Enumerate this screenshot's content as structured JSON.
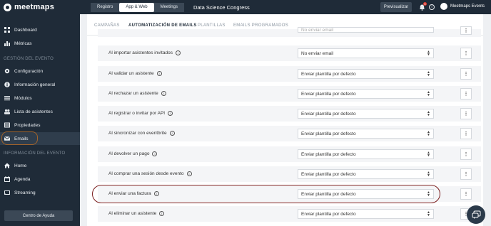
{
  "brand": {
    "name": "meetmaps"
  },
  "sidebar": {
    "items_top": [
      {
        "label": "Dashboard",
        "icon": "dashboard-icon"
      },
      {
        "label": "Métricas",
        "icon": "chart-icon"
      }
    ],
    "section_event": "GESTIÓN DEL EVENTO",
    "items_event": [
      {
        "label": "Configuración",
        "icon": "gear-icon"
      },
      {
        "label": "Información general",
        "icon": "info-icon"
      },
      {
        "label": "Módulos",
        "icon": "list-icon"
      },
      {
        "label": "Lista de asistentes",
        "icon": "users-icon"
      },
      {
        "label": "Propiedades",
        "icon": "properties-icon"
      },
      {
        "label": "Emails",
        "icon": "mail-icon"
      }
    ],
    "section_info": "INFORMACIÓN DEL EVENTO",
    "items_info": [
      {
        "label": "Home",
        "icon": "home-icon"
      },
      {
        "label": "Agenda",
        "icon": "calendar-icon"
      },
      {
        "label": "Streaming",
        "icon": "streaming-icon"
      }
    ],
    "help_label": "Centro de Ayuda"
  },
  "topbar": {
    "tabs": [
      "Registro",
      "App & Web",
      "Meetings"
    ],
    "active_tab": "App & Web",
    "event_name": "Data Science Congress",
    "preview_label": "Previsualizar",
    "notification_count": "5",
    "account_name": "Meetmaps Events"
  },
  "subtabs": {
    "items": [
      "CAMPAÑAS",
      "AUTOMATIZACIÓN DE EMAILS",
      "PLANTILLAS",
      "EMAILS PROGRAMADOS"
    ],
    "active": "AUTOMATIZACIÓN DE EMAILS"
  },
  "rules": [
    {
      "label": "Al importar asistentes invitados",
      "value": "No enviar email"
    },
    {
      "label": "Al validar un asistente",
      "value": "Enviar plantilla por defecto"
    },
    {
      "label": "Al rechazar un asistente",
      "value": "Enviar plantilla por defecto"
    },
    {
      "label": "Al registrar o invitar por API",
      "value": "Enviar plantilla por defecto"
    },
    {
      "label": "Al sincronizar con eventbrite",
      "value": "Enviar plantilla por defecto"
    },
    {
      "label": "Al devolver un pago",
      "value": "Enviar plantilla por defecto"
    },
    {
      "label": "Al comprar una sesión desde evento",
      "value": "Enviar plantilla por defecto"
    },
    {
      "label": "Al enviar una factura",
      "value": "Enviar plantilla por defecto"
    },
    {
      "label": "Al eliminar un asistente",
      "value": "Enviar plantilla por defecto"
    }
  ],
  "partial_top_row": {
    "value": "No enviar email"
  },
  "colors": {
    "sidebar_bg": "#1f2b38",
    "highlight_emails": "#a1632a",
    "highlight_factura": "#7a1d1d"
  }
}
